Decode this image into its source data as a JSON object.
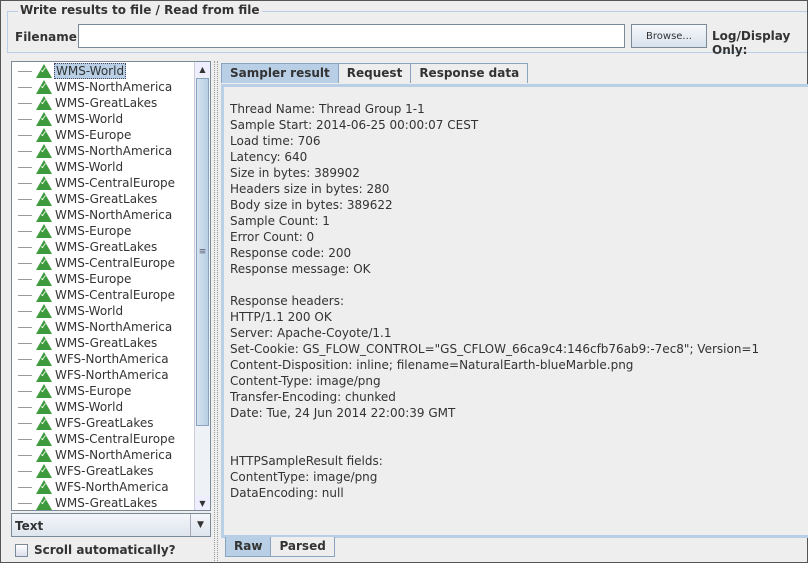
{
  "file_group": {
    "title": "Write results to file / Read from file",
    "filename_label": "Filename",
    "filename_value": "",
    "browse_label": "Browse...",
    "log_display_label": "Log/Display Only:"
  },
  "tree": {
    "items": [
      "WMS-World",
      "WMS-NorthAmerica",
      "WMS-GreatLakes",
      "WMS-World",
      "WMS-Europe",
      "WMS-NorthAmerica",
      "WMS-World",
      "WMS-CentralEurope",
      "WMS-GreatLakes",
      "WMS-NorthAmerica",
      "WMS-Europe",
      "WMS-GreatLakes",
      "WMS-CentralEurope",
      "WMS-Europe",
      "WMS-CentralEurope",
      "WMS-World",
      "WMS-NorthAmerica",
      "WMS-GreatLakes",
      "WFS-NorthAmerica",
      "WFS-NorthAmerica",
      "WMS-Europe",
      "WMS-World",
      "WFS-GreatLakes",
      "WMS-CentralEurope",
      "WMS-NorthAmerica",
      "WFS-GreatLakes",
      "WFS-NorthAmerica",
      "WMS-GreatLakes"
    ],
    "selected_index": 0,
    "item_icon": "success-triangle-icon"
  },
  "renderer": {
    "selected": "Text"
  },
  "scroll_auto": {
    "label": "Scroll automatically?",
    "checked": false
  },
  "tabs": [
    "Sampler result",
    "Request",
    "Response data"
  ],
  "active_tab": 0,
  "result_lines": [
    "Thread Name: Thread Group 1-1",
    "Sample Start: 2014-06-25 00:00:07 CEST",
    "Load time: 706",
    "Latency: 640",
    "Size in bytes: 389902",
    "Headers size in bytes: 280",
    "Body size in bytes: 389622",
    "Sample Count: 1",
    "Error Count: 0",
    "Response code: 200",
    "Response message: OK",
    "",
    "Response headers:",
    "HTTP/1.1 200 OK",
    "Server: Apache-Coyote/1.1",
    "Set-Cookie: GS_FLOW_CONTROL=\"GS_CFLOW_66ca9c4:146cfb76ab9:-7ec8\"; Version=1",
    "Content-Disposition: inline; filename=NaturalEarth-blueMarble.png",
    "Content-Type: image/png",
    "Transfer-Encoding: chunked",
    "Date: Tue, 24 Jun 2014 22:00:39 GMT",
    "",
    "",
    "HTTPSampleResult fields:",
    "ContentType: image/png",
    "DataEncoding: null"
  ],
  "bottom_tabs": [
    "Raw",
    "Parsed"
  ],
  "active_bottom_tab": 0
}
